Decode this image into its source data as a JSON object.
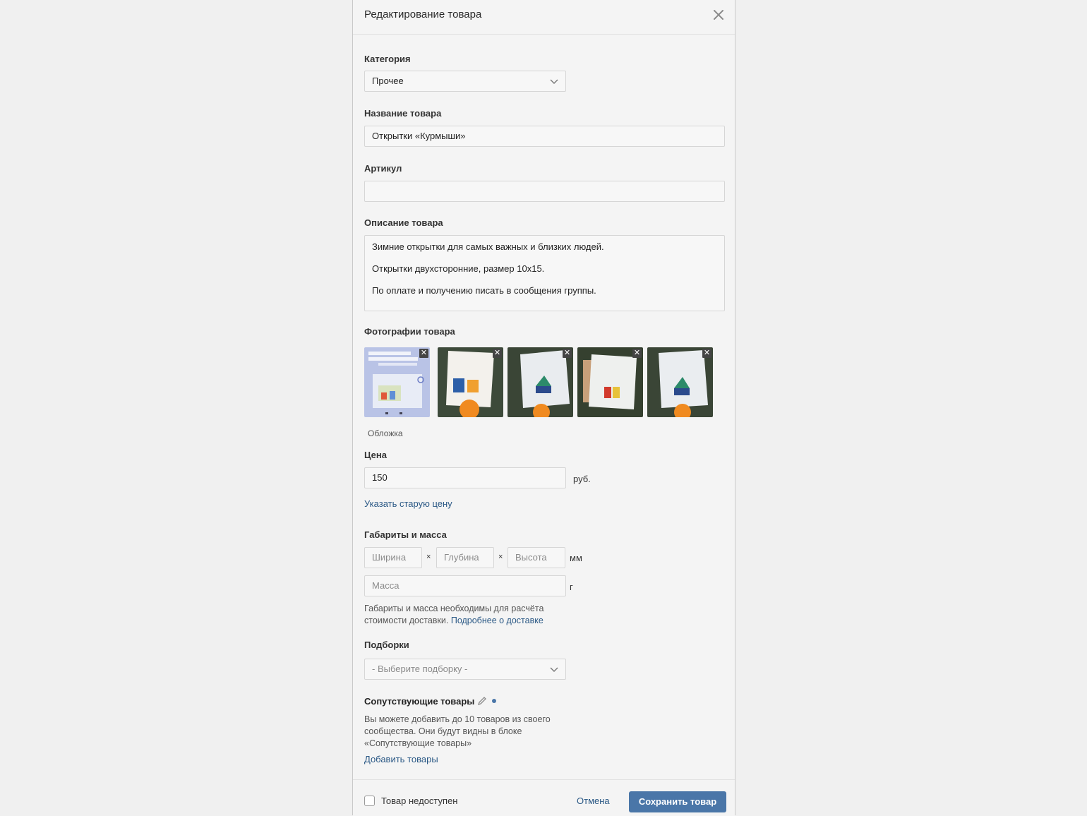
{
  "modal": {
    "title": "Редактирование товара",
    "close_icon": "close-icon"
  },
  "category": {
    "label": "Категория",
    "value": "Прочее"
  },
  "name": {
    "label": "Название товара",
    "value": "Открытки «Курмыши»"
  },
  "sku": {
    "label": "Артикул",
    "value": ""
  },
  "description": {
    "label": "Описание товара",
    "lines": [
      "Зимние открытки для самых важных и близких людей.",
      "Открытки двухсторонние, размер 10x15.",
      "По оплате и получению писать в сообщения группы."
    ]
  },
  "photos": {
    "label": "Фотографии товара",
    "cover_caption": "Обложка",
    "remove_symbol": "✕"
  },
  "price": {
    "label": "Цена",
    "value": "150",
    "unit": "руб.",
    "old_price_link": "Указать старую цену"
  },
  "dimensions": {
    "label": "Габариты и масса",
    "width_placeholder": "Ширина",
    "depth_placeholder": "Глубина",
    "height_placeholder": "Высота",
    "separator": "×",
    "size_unit": "мм",
    "mass_placeholder": "Масса",
    "mass_unit": "г",
    "hint_line1": "Габариты и масса необходимы для расчёта",
    "hint_line2": "стоимости доставки.",
    "delivery_link": "Подробнее о доставке"
  },
  "collections": {
    "label": "Подборки",
    "placeholder": "- Выберите подборку -"
  },
  "related": {
    "label": "Сопутствующие товары",
    "hint_line1": "Вы можете добавить до 10 товаров из своего",
    "hint_line2": "сообщества. Они будут видны в блоке",
    "hint_line3": "«Сопутствующие товары»",
    "add_link": "Добавить товары"
  },
  "footer": {
    "unavailable_label": "Товар недоступен",
    "cancel_label": "Отмена",
    "save_label": "Сохранить товар"
  }
}
